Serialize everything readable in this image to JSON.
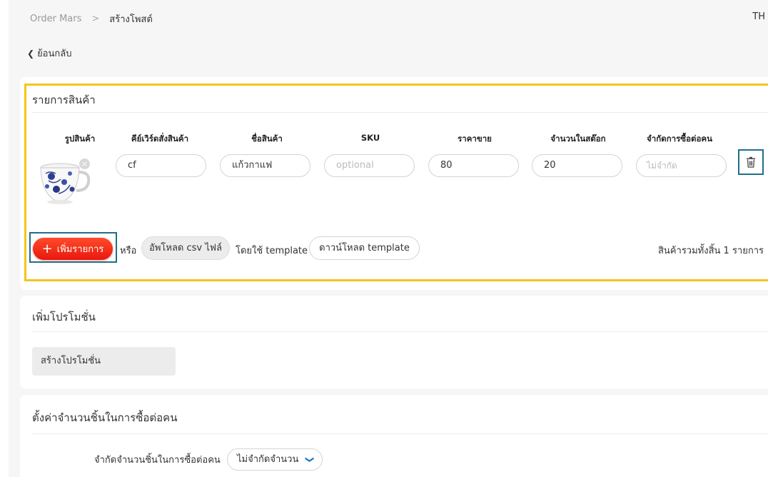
{
  "breadcrumb": {
    "root": "Order Mars",
    "separator": ">",
    "current": "สร้างโพสต์"
  },
  "lang": "TH",
  "back_label": "ย้อนกลับ",
  "products": {
    "title": "รายการสินค้า",
    "columns": {
      "image": "รูปสินค้า",
      "keyword": "คีย์เวิร์ดสั่งสินค้า",
      "name": "ชื่อสินค้า",
      "sku": "SKU",
      "price": "ราคาขาย",
      "stock": "จำนวนในสต๊อก",
      "limit": "จำกัดการซื้อต่อคน"
    },
    "row": {
      "keyword": "cf",
      "name": "แก้วกาแฟ",
      "sku_placeholder": "optional",
      "price": "80",
      "stock": "20",
      "limit_placeholder": "ไม่จำกัด"
    },
    "add_label": "เพิ่มรายการ",
    "or": "หรือ",
    "upload_label": "อัพโหลด csv ไฟล์",
    "using": "โดยใช้ template",
    "download_label": "ดาวน์โหลด template",
    "total": "สินค้ารวมทั้งสิ้น 1 รายการ"
  },
  "promo": {
    "title": "เพิ่มโปรโมชั่น",
    "create_label": "สร้างโปรโมชั่น"
  },
  "limit": {
    "title": "ตั้งค่าจำนวนชิ้นในการซื้อต่อคน",
    "label": "จำกัดจำนวนชิ้นในการซื้อต่อคน",
    "value": "ไม่จำกัดจำนวน"
  },
  "colors": {
    "accent_red": "#e8180c",
    "highlight_yellow": "#f5c518",
    "highlight_teal": "#1f6e8c"
  },
  "icons": {
    "back": "chevron-left-icon",
    "delete": "trash-icon",
    "remove_image": "close-icon",
    "select": "chevron-down-icon"
  }
}
